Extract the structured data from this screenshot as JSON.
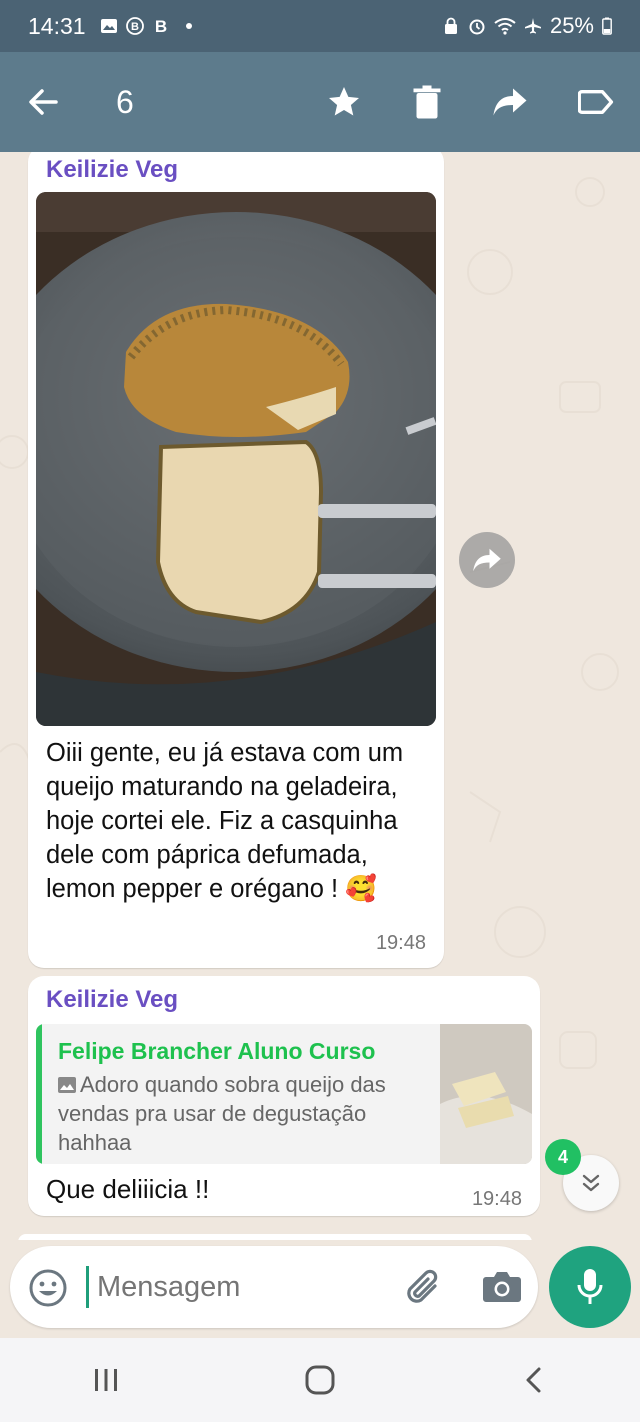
{
  "status_bar": {
    "time": "14:31",
    "battery": "25%"
  },
  "app_bar": {
    "selected_count": "6"
  },
  "messages": [
    {
      "sender": "Keilizie Veg",
      "text": "Oiii gente, eu já estava com um queijo maturando na geladeira, hoje cortei ele. Fiz a casquinha dele com páprica defumada, lemon pepper e orégano ! 🥰",
      "time": "19:48"
    },
    {
      "sender": "Keilizie Veg",
      "quote": {
        "author": "Felipe Brancher Aluno Curso",
        "text": "Adoro quando sobra queijo das vendas pra usar de degustação hahhaa"
      },
      "text": "Que deliiicia !!",
      "time": "19:48"
    }
  ],
  "unread_badge": "4",
  "composer": {
    "placeholder": "Mensagem"
  },
  "colors": {
    "status_bar": "#4b6374",
    "app_bar": "#5d7b8c",
    "sender": "#6a4fc2",
    "quote_author": "#1ec14e",
    "accent": "#1fa37f",
    "chat_background": "#efe7de"
  },
  "icons": [
    "back-arrow-icon",
    "star-icon",
    "trash-icon",
    "forward-icon",
    "label-icon",
    "emoji-icon",
    "attach-icon",
    "camera-icon",
    "mic-icon",
    "chevron-double-down-icon",
    "recent-apps-icon",
    "home-icon",
    "nav-back-icon"
  ]
}
